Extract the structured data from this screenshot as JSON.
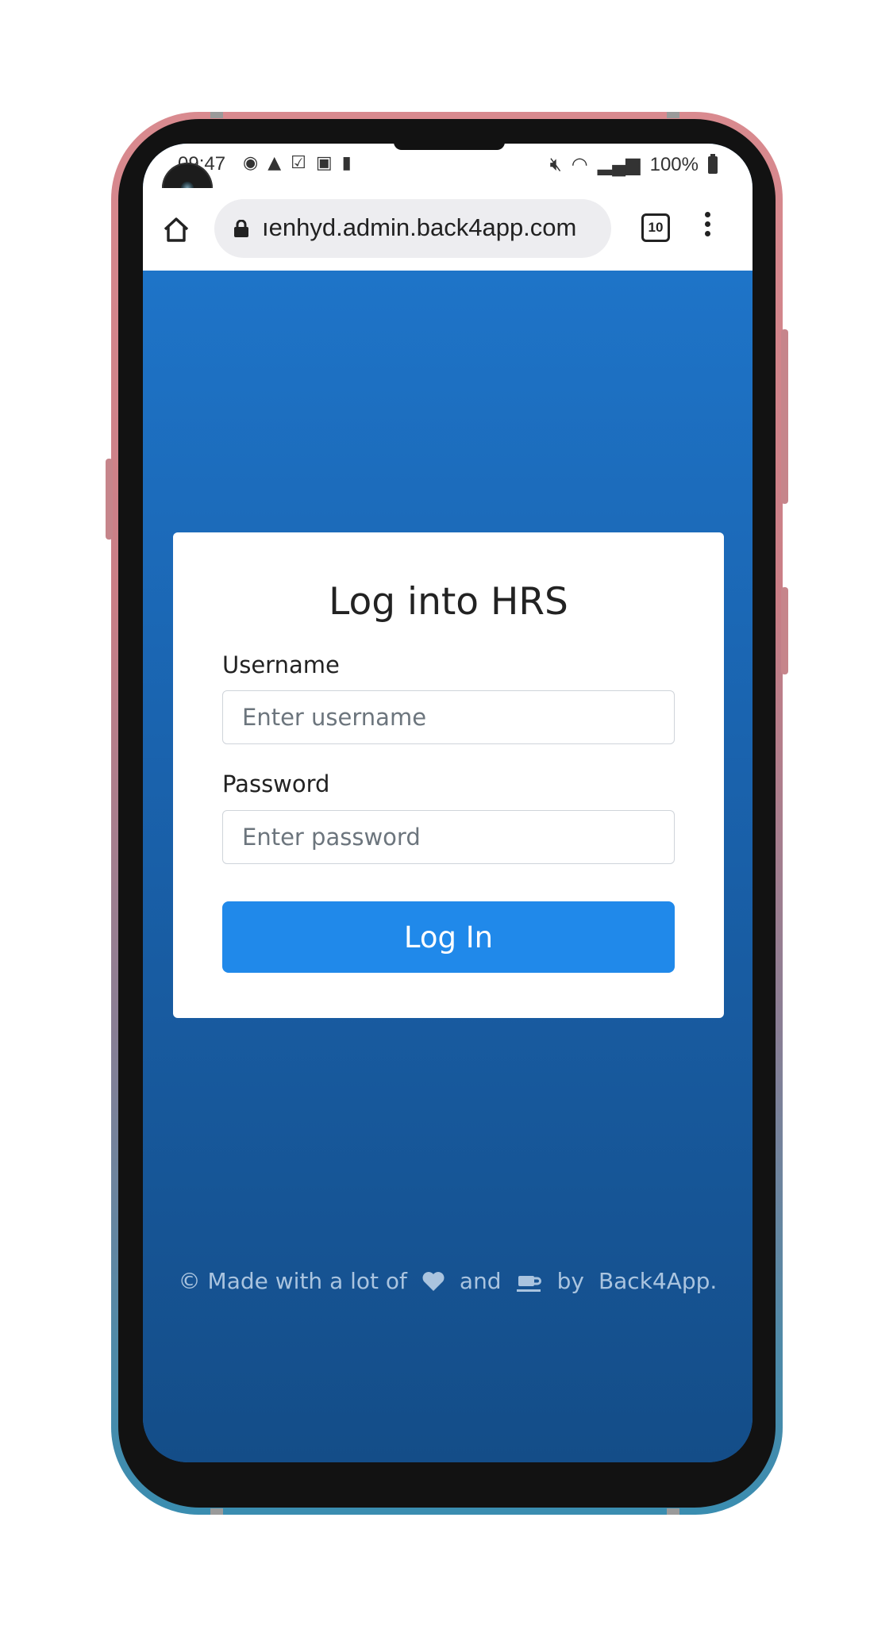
{
  "status_bar": {
    "time": "09:47",
    "battery_text": "100%"
  },
  "browser": {
    "url": "ıenhyd.admin.back4app.com",
    "tab_count": "10"
  },
  "login_card": {
    "title": "Log into HRS",
    "username_label": "Username",
    "username_placeholder": "Enter username",
    "password_label": "Password",
    "password_placeholder": "Enter password",
    "submit_label": "Log In"
  },
  "footer": {
    "prefix": "© Made with a lot of",
    "and_text": "and",
    "by_text": "by",
    "brand": "Back4App."
  },
  "colors": {
    "page_bg_top": "#1e74c8",
    "page_bg_bottom": "#144d88",
    "button": "#2089ea",
    "footer_text": "#aac4df"
  }
}
